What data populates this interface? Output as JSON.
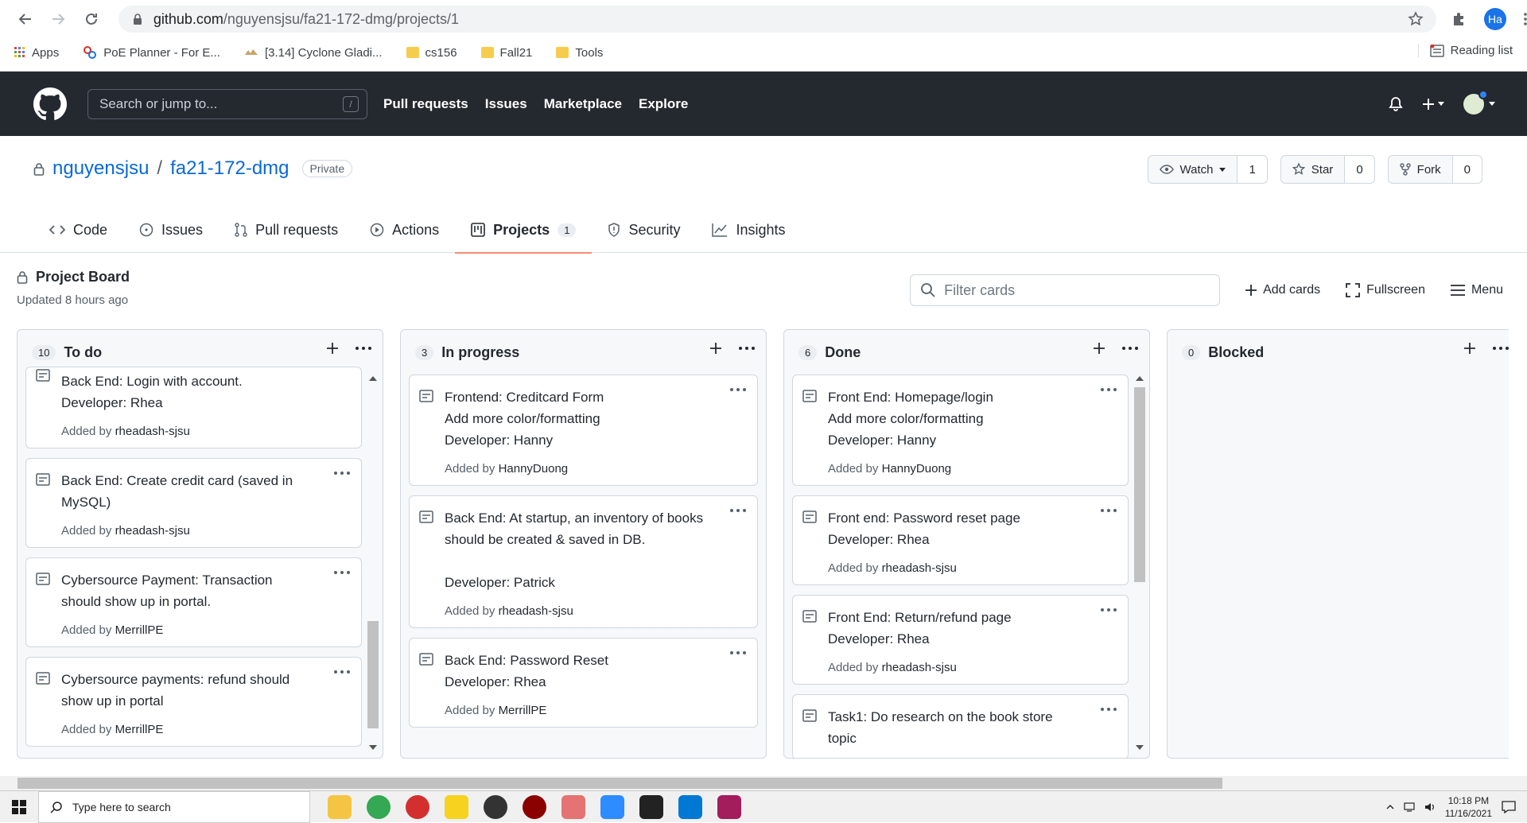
{
  "browser": {
    "url_host": "github.com",
    "url_path": "/nguyensjsu/fa21-172-dmg/projects/1",
    "profile_initials": "Ha",
    "bookmarks": [
      "Apps",
      "PoE Planner - For E...",
      "[3.14] Cyclone Gladi...",
      "cs156",
      "Fall21",
      "Tools"
    ],
    "reading_list": "Reading list"
  },
  "gh_header": {
    "search_placeholder": "Search or jump to...",
    "search_hotkey": "/",
    "nav": [
      "Pull requests",
      "Issues",
      "Marketplace",
      "Explore"
    ]
  },
  "repo": {
    "owner": "nguyensjsu",
    "separator": "/",
    "name": "fa21-172-dmg",
    "visibility": "Private",
    "watch_label": "Watch",
    "watch_count": "1",
    "star_label": "Star",
    "star_count": "0",
    "fork_label": "Fork",
    "fork_count": "0"
  },
  "tabs": [
    {
      "label": "Code"
    },
    {
      "label": "Issues"
    },
    {
      "label": "Pull requests"
    },
    {
      "label": "Actions"
    },
    {
      "label": "Projects",
      "counter": "1"
    },
    {
      "label": "Security"
    },
    {
      "label": "Insights"
    }
  ],
  "project": {
    "title": "Project Board",
    "updated": "Updated 8 hours ago",
    "filter_placeholder": "Filter cards",
    "add_cards": "Add cards",
    "fullscreen": "Fullscreen",
    "menu": "Menu"
  },
  "columns": [
    {
      "count": "10",
      "name": "To do",
      "cards": [
        {
          "text": "Back End: Login with account.\nDeveloper: Rhea",
          "added_prefix": "Added by",
          "author": "rheadash-sjsu"
        },
        {
          "text": "Back End: Create credit card (saved in\nMySQL)",
          "added_prefix": "Added by",
          "author": "rheadash-sjsu"
        },
        {
          "text": "Cybersource Payment: Transaction\nshould show up in portal.",
          "added_prefix": "Added by",
          "author": "MerrillPE"
        },
        {
          "text": "Cybersource payments: refund should\nshow up in portal",
          "added_prefix": "Added by",
          "author": "MerrillPE"
        }
      ]
    },
    {
      "count": "3",
      "name": "In progress",
      "cards": [
        {
          "text": "Frontend: Creditcard Form\nAdd more color/formatting\nDeveloper: Hanny",
          "added_prefix": "Added by",
          "author": "HannyDuong"
        },
        {
          "text": "Back End: At startup, an inventory of books\nshould be created & saved in DB.\n\nDeveloper: Patrick",
          "added_prefix": "Added by",
          "author": "rheadash-sjsu"
        },
        {
          "text": "Back End: Password Reset\nDeveloper: Rhea",
          "added_prefix": "Added by",
          "author": "MerrillPE"
        }
      ]
    },
    {
      "count": "6",
      "name": "Done",
      "cards": [
        {
          "text": "Front End: Homepage/login\nAdd more color/formatting\nDeveloper: Hanny",
          "added_prefix": "Added by",
          "author": "HannyDuong"
        },
        {
          "text": "Front end: Password reset page\nDeveloper: Rhea",
          "added_prefix": "Added by",
          "author": "rheadash-sjsu"
        },
        {
          "text": "Front End: Return/refund page\nDeveloper: Rhea",
          "added_prefix": "Added by",
          "author": "rheadash-sjsu"
        },
        {
          "text": "Task1: Do research on the book store\ntopic",
          "added_prefix": "",
          "author": ""
        }
      ]
    },
    {
      "count": "0",
      "name": "Blocked",
      "cards": []
    }
  ],
  "taskbar": {
    "search_placeholder": "Type here to search",
    "time": "10:18 PM",
    "date": "11/16/2021"
  },
  "colors": {
    "gh_header_bg": "#24292f",
    "link_blue": "#0969da",
    "tab_underline": "#fd8c73"
  }
}
